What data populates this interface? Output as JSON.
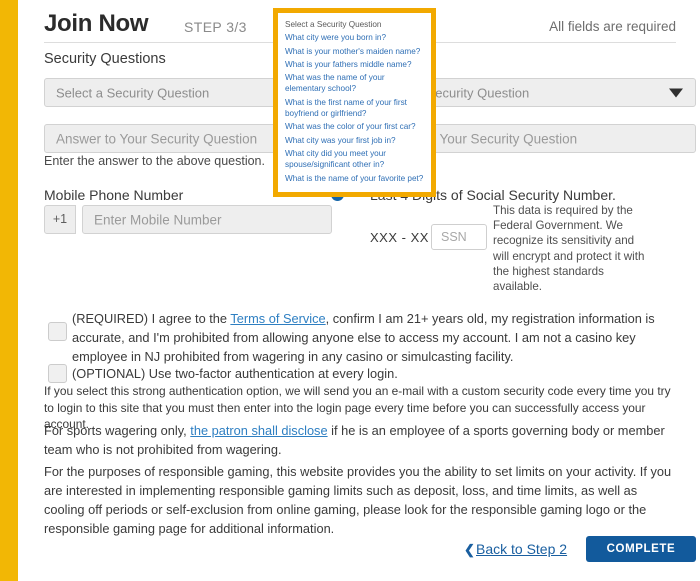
{
  "brand": {
    "accent_yellow": "#f2b705",
    "link_blue": "#2e7fc2",
    "button_blue": "#125a9c",
    "dropdown_border": "#f2a900"
  },
  "header": {
    "title": "Join Now",
    "step": "STEP 3/3",
    "all_fields_note": "All fields are required"
  },
  "section": {
    "label": "Security Questions"
  },
  "security": {
    "select_left_value": "Select a Security Question",
    "select_right_value": "Select a Security Question",
    "answer_left_placeholder": "Answer to Your Security Question",
    "answer_right_placeholder": "Answer to Your Security Question",
    "hint": "Enter the answer to the above question.",
    "caret_icon": "chevron-down-icon"
  },
  "dropdown": {
    "open": true,
    "options": [
      "Select a Security Question",
      "What city were you born in?",
      "What is your mother's maiden name?",
      "What is your fathers middle name?",
      "What was the name of your elementary school?",
      "What is the first name of your first boyfriend or girlfriend?",
      "What was the color of your first car?",
      "What city was your first job in?",
      "What city did you meet your spouse/significant other in?",
      "What is the name of your favorite pet?"
    ]
  },
  "phone": {
    "label": "Mobile Phone Number",
    "info_icon": "info-circle-icon",
    "info_glyph": "i",
    "country_code": "+1",
    "placeholder": "Enter Mobile Number"
  },
  "ssn": {
    "label": "Last 4 Digits of Social Security Number.",
    "prefix": "XXX - XX -",
    "placeholder": "SSN",
    "note": "This data is required by the Federal Government. We recognize its sensitivity and will encrypt and protect it with the highest standards available."
  },
  "agreements": {
    "required": {
      "checked": false,
      "prefix": "(REQUIRED) I agree to the ",
      "link_text": "Terms of Service",
      "suffix": ", confirm I am 21+ years old, my registration information is accurate, and I'm prohibited from allowing anyone else to access my account. I am not a casino key employee in NJ prohibited from wagering in any casino or simulcasting facility."
    },
    "optional": {
      "checked": false,
      "label": "(OPTIONAL) Use two-factor authentication at every login.",
      "note": "If you select this strong authentication option, we will send you an e-mail with a custom security code every time you try to login to this site that you must then enter into the login page every time before you can successfully access your account."
    }
  },
  "paragraphs": {
    "sports_prefix": "For sports wagering only, ",
    "sports_link": "the patron shall disclose",
    "sports_suffix": " if he is an employee of a sports governing body or member team who is not prohibited from wagering.",
    "gaming": "For the purposes of responsible gaming, this website provides you the ability to set limits on your activity. If you are interested in implementing responsible gaming limits such as deposit, loss, and time limits, as well as cooling off periods or self-exclusion from online gaming, please look for the responsible gaming logo or the responsible gaming page for additional information."
  },
  "footer": {
    "back_chevron_icon": "chevron-left-icon",
    "back_chevron": "❮",
    "back_label": "Back to Step 2",
    "complete_label": "COMPLETE"
  }
}
